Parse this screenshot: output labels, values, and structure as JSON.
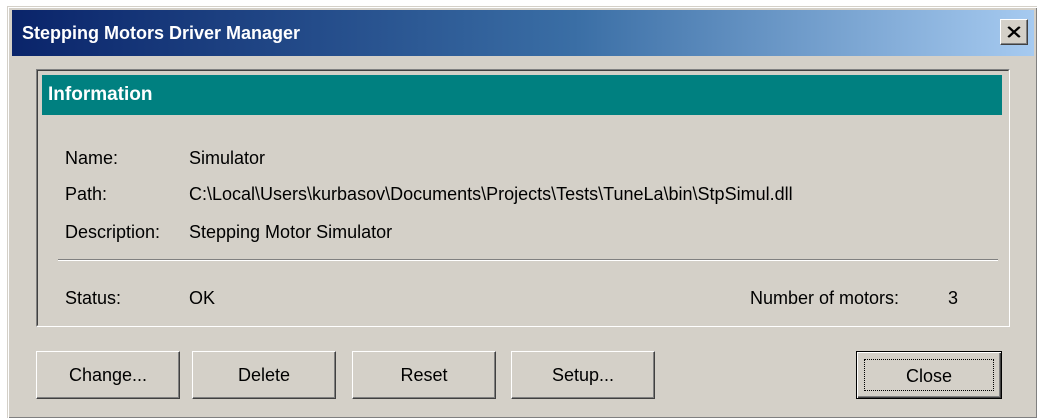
{
  "window": {
    "title": "Stepping Motors Driver Manager"
  },
  "info": {
    "header": "Information",
    "name_label": "Name:",
    "name_value": "Simulator",
    "path_label": "Path:",
    "path_value": "C:\\Local\\Users\\kurbasov\\Documents\\Projects\\Tests\\TuneLa\\bin\\StpSimul.dll",
    "description_label": "Description:",
    "description_value": "Stepping Motor Simulator",
    "status_label": "Status:",
    "status_value": "OK",
    "motors_label": "Number of motors:",
    "motors_value": "3"
  },
  "buttons": {
    "change": "Change...",
    "delete": "Delete",
    "reset": "Reset",
    "setup": "Setup...",
    "close": "Close"
  },
  "colors": {
    "title_gradient_start": "#0a246a",
    "title_gradient_end": "#a6caf0",
    "section_header": "#008080",
    "window_face": "#d4d0c8"
  },
  "icons": {
    "title_close": "close-icon"
  }
}
